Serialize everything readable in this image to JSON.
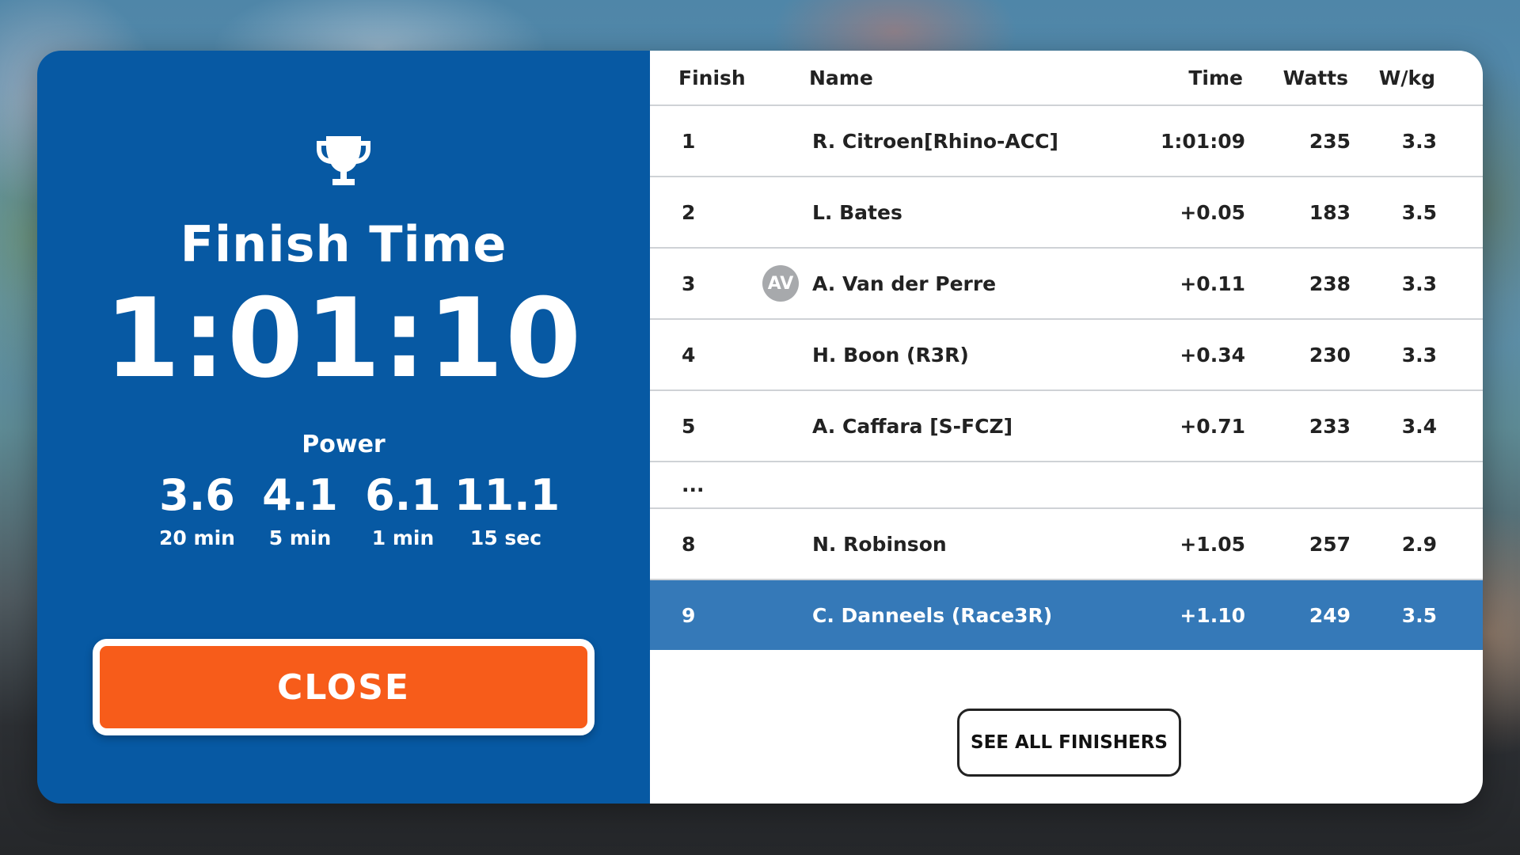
{
  "summary": {
    "icon": "trophy-icon",
    "title": "Finish Time",
    "time": "1:01:10",
    "power_label": "Power",
    "power": [
      {
        "value": "3.6",
        "unit": "20 min"
      },
      {
        "value": "4.1",
        "unit": "5 min"
      },
      {
        "value": "6.1",
        "unit": "1 min"
      },
      {
        "value": "11.1",
        "unit": "15 sec"
      }
    ],
    "close_label": "CLOSE"
  },
  "results": {
    "headers": {
      "finish": "Finish",
      "name": "Name",
      "time": "Time",
      "watts": "Watts",
      "wkg": "W/kg"
    },
    "rows": [
      {
        "finish": "1",
        "name": "R. Citroen[Rhino-ACC]",
        "time": "1:01:09",
        "watts": "235",
        "wkg": "3.3"
      },
      {
        "finish": "2",
        "name": "L. Bates",
        "time": "+0.05",
        "watts": "183",
        "wkg": "3.5"
      },
      {
        "finish": "3",
        "avatar": "AV",
        "name": "A. Van der Perre",
        "time": "+0.11",
        "watts": "238",
        "wkg": "3.3"
      },
      {
        "finish": "4",
        "name": "H. Boon (R3R)",
        "time": "+0.34",
        "watts": "230",
        "wkg": "3.3"
      },
      {
        "finish": "5",
        "name": "A. Caffara [S-FCZ]",
        "time": "+0.71",
        "watts": "233",
        "wkg": "3.4"
      },
      {
        "finish": "..."
      },
      {
        "finish": "8",
        "name": "N. Robinson",
        "time": "+1.05",
        "watts": "257",
        "wkg": "2.9"
      },
      {
        "finish": "9",
        "name": "C. Danneels (Race3R)",
        "time": "+1.10",
        "watts": "249",
        "wkg": "3.5",
        "highlighted": true
      }
    ],
    "see_all_label": "SEE ALL FINISHERS"
  },
  "colors": {
    "panel_blue": "#0759a3",
    "highlight_blue": "#3579b8",
    "close_orange": "#f75c1a",
    "avatar_gray": "#a7a9ac"
  }
}
